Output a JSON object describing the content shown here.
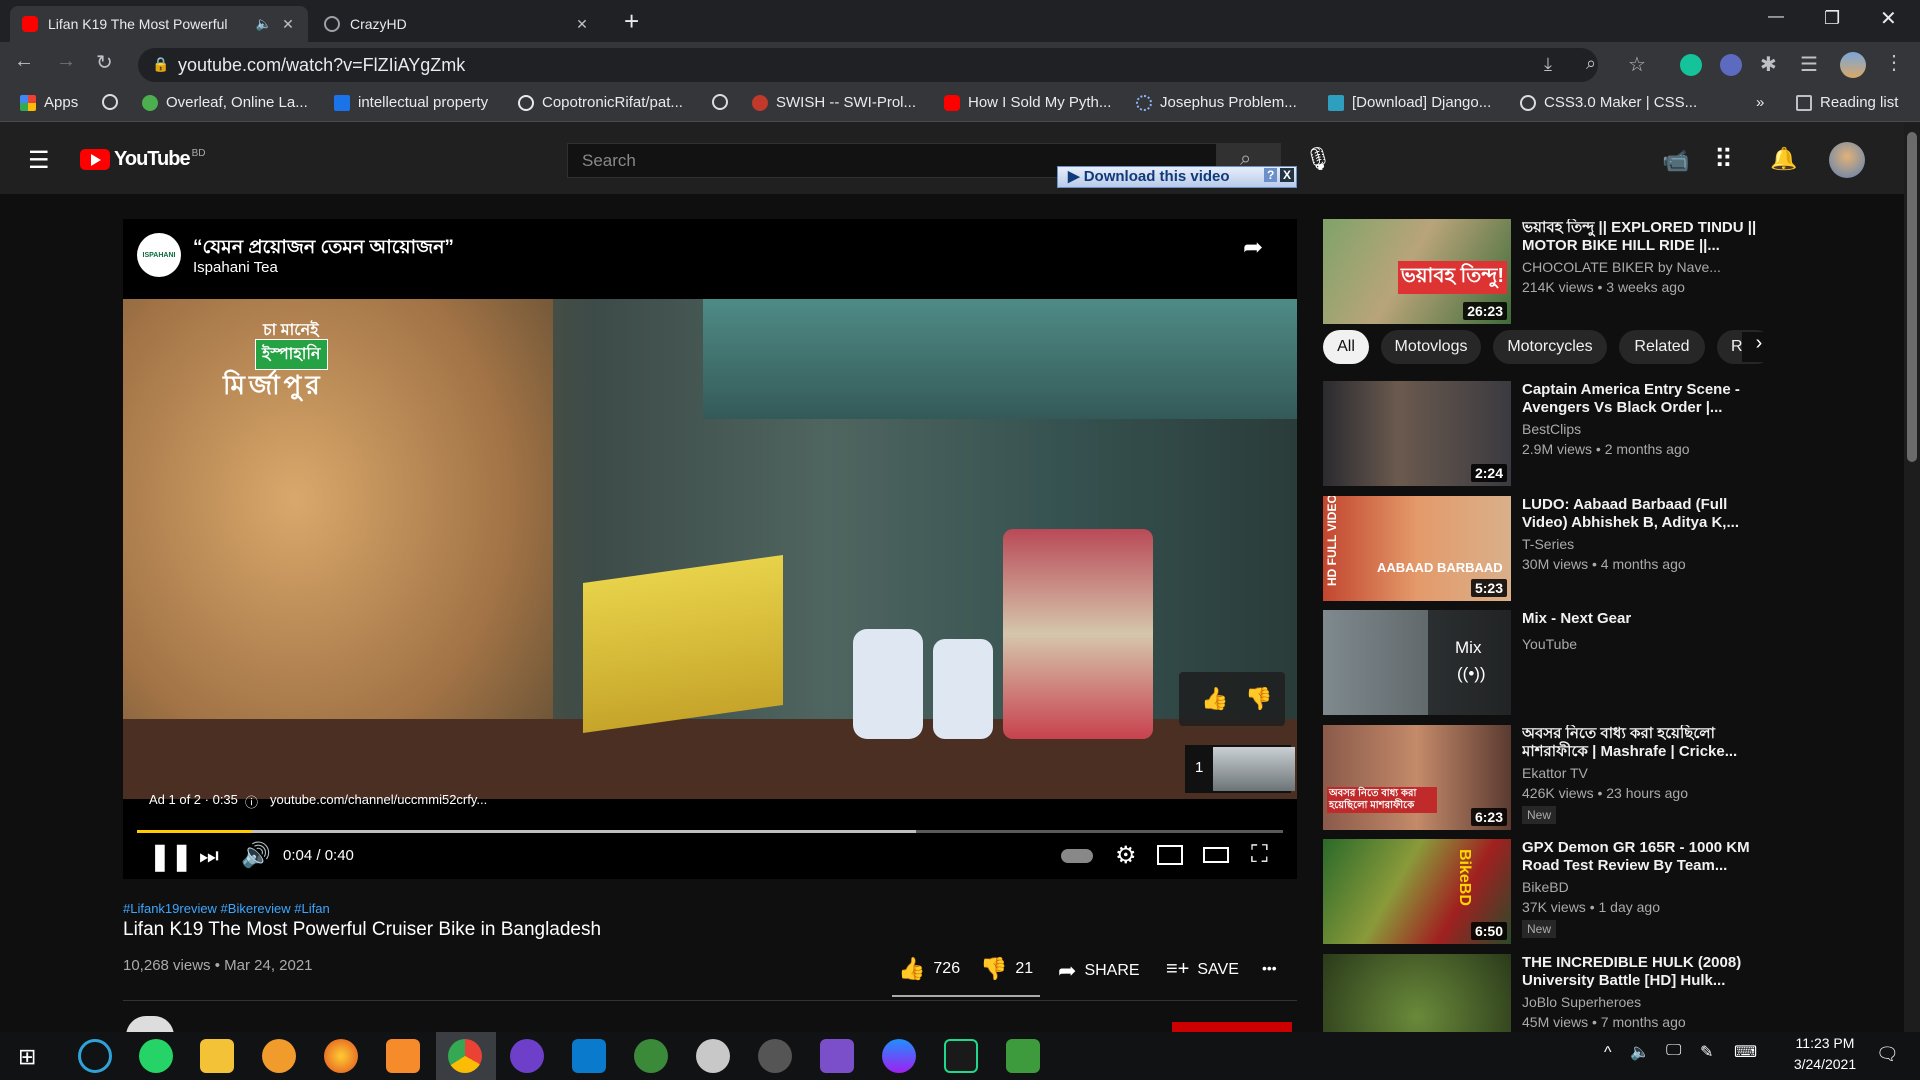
{
  "browser": {
    "tabs": [
      {
        "title": "Lifan K19 The Most Powerful",
        "active": true
      },
      {
        "title": "CrazyHD",
        "active": false
      }
    ],
    "new_tab": "+",
    "window_controls": {
      "minimize": "—",
      "maximize": "❐",
      "close": "✕"
    },
    "url": "youtube.com/watch?v=FlZIiAYgZmk",
    "bookmarks": [
      {
        "label": "Apps",
        "icon": "apps-grid-icon"
      },
      {
        "label": "",
        "icon": "globe-icon"
      },
      {
        "label": "Overleaf, Online La...",
        "icon": "overleaf-icon"
      },
      {
        "label": "intellectual property",
        "icon": "s-icon"
      },
      {
        "label": "CopotronicRifat/pat...",
        "icon": "github-icon"
      },
      {
        "label": "",
        "icon": "globe-icon"
      },
      {
        "label": "SWISH -- SWI-Prol...",
        "icon": "swish-icon"
      },
      {
        "label": "How I Sold My Pyth...",
        "icon": "youtube-icon"
      },
      {
        "label": "Josephus Problem...",
        "icon": "loading-icon"
      },
      {
        "label": "[Download] Django...",
        "icon": "django-icon"
      },
      {
        "label": "CSS3.0 Maker | CSS...",
        "icon": "globe-icon"
      }
    ],
    "bookmarks_more": "»",
    "reading_list": "Reading list"
  },
  "youtube": {
    "logo_text": "YouTube",
    "logo_country": "BD",
    "search_placeholder": "Search",
    "download_bar": "Download this video",
    "download_help": "?",
    "download_close": "X"
  },
  "player": {
    "ad_title": "“যেমন প্রয়োজন তেমন আয়োজন”",
    "ad_channel": "Ispahani Tea",
    "ad_logo_text": "ISPAHANI",
    "overlay_line1": "চা মানেই",
    "overlay_line2": "ইস্পাহানি",
    "overlay_line3": "মির্জাপুর",
    "ad_info": "Ad 1 of 2 · 0:35",
    "ad_url": "youtube.com/channel/uccmmi52crfy...",
    "time": "0:04 / 0:40",
    "queue_number": "1",
    "progress": 0.68,
    "watched": 0.1
  },
  "video": {
    "hashtags": "#Lifank19review #Bikereview #Lifan",
    "title": "Lifan K19 The Most Powerful Cruiser Bike in Bangladesh",
    "meta": "10,268 views • Mar 24, 2021",
    "likes": "726",
    "dislikes": "21",
    "share": "SHARE",
    "save": "SAVE",
    "more": "•••"
  },
  "sidebar": {
    "chips": [
      "All",
      "Motovlogs",
      "Motorcycles",
      "Related",
      "Re"
    ],
    "recommendations": [
      {
        "title": "ভয়াবহ তিন্দু || EXPLORED TINDU || MOTOR BIKE HILL RIDE ||...",
        "channel": "CHOCOLATE BIKER by Nave...",
        "meta": "214K views • 3 weeks ago",
        "duration": "26:23",
        "thumb_text": "ভয়াবহ তিন্দু!",
        "badge": ""
      },
      {
        "title": "Captain America Entry Scene - Avengers Vs Black Order |...",
        "channel": "BestClips",
        "meta": "2.9M views • 2 months ago",
        "duration": "2:24",
        "badge": ""
      },
      {
        "title": "LUDO: Aabaad Barbaad (Full Video) Abhishek B, Aditya K,...",
        "channel": "T-Series",
        "meta": "30M views • 4 months ago",
        "duration": "5:23",
        "thumb_text": "AABAAD BARBAAD",
        "side_text": "HD FULL VIDEO",
        "badge": ""
      },
      {
        "title": "Mix - Next Gear",
        "channel": "YouTube",
        "meta": "",
        "duration": "",
        "mix_label": "Mix",
        "badge": ""
      },
      {
        "title": "অবসর নিতে বাধ্য করা হয়েছিলো মাশরাফীকে | Mashrafe | Cricke...",
        "channel": "Ekattor TV",
        "meta": "426K views • 23 hours ago",
        "duration": "6:23",
        "thumb_text": "অবসর নিতে বাধ্য করা হয়েছিলো মাশরাফীকে",
        "badge": "New"
      },
      {
        "title": "GPX Demon GR 165R - 1000 KM Road Test Review By Team...",
        "channel": "BikeBD",
        "meta": "37K views • 1 day ago",
        "duration": "6:50",
        "thumb_text": "BikeBD",
        "badge": "New"
      },
      {
        "title": "THE INCREDIBLE HULK (2008) University Battle [HD] Hulk...",
        "channel": "JoBlo Superheroes",
        "meta": "45M views • 7 months ago",
        "duration": "",
        "badge": ""
      }
    ]
  },
  "taskbar": {
    "time": "11:23 PM",
    "date": "3/24/2021"
  },
  "colors": {
    "yt_red": "#ff0000",
    "progress_red": "#ff0000",
    "ad_yellow": "#ffcc00",
    "link_blue": "#3ea6ff"
  }
}
